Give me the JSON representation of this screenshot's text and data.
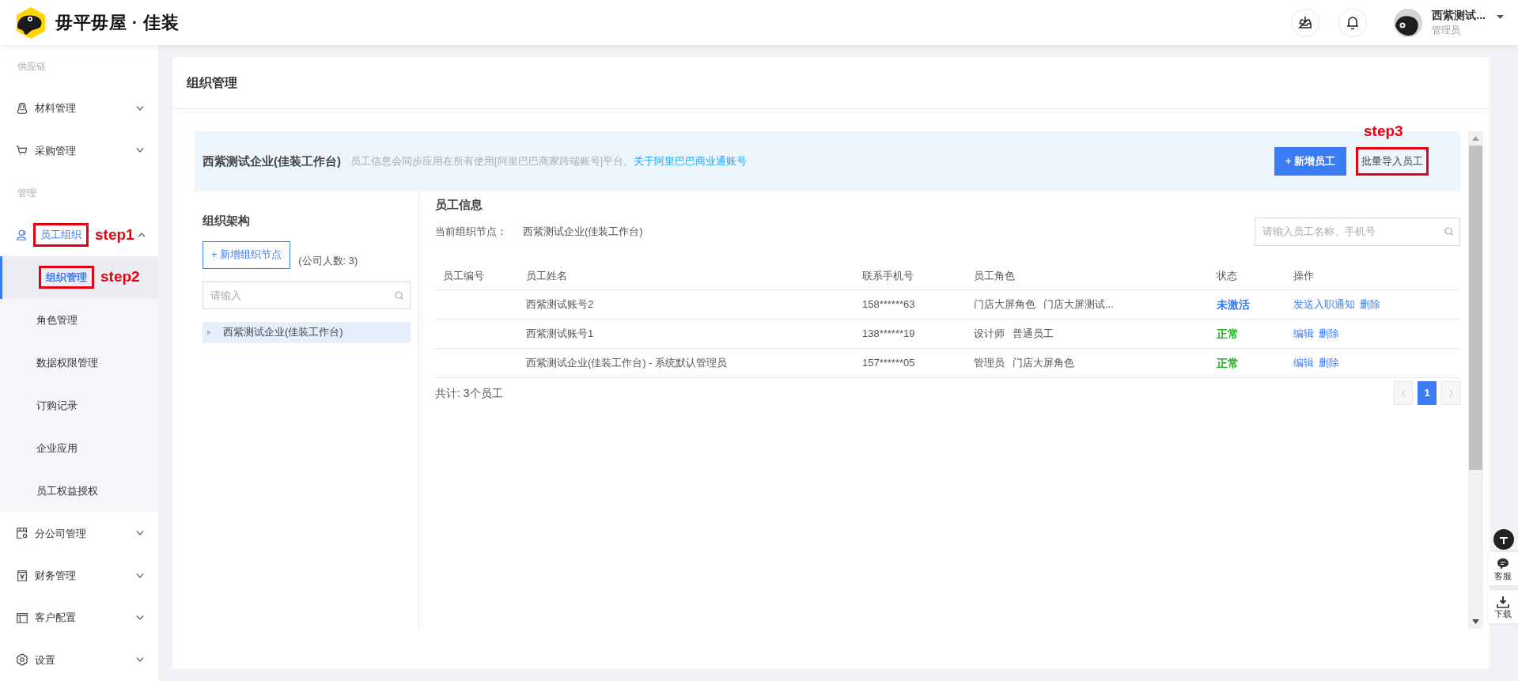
{
  "header": {
    "brand": "毋平毋屋 · 佳装",
    "user": {
      "name": "西紫测试...",
      "role": "管理员"
    }
  },
  "sidebar": {
    "sections": [
      {
        "label": "供应链",
        "items": [
          {
            "label": "材料管理",
            "expanded": false
          },
          {
            "label": "采购管理",
            "expanded": false
          }
        ]
      },
      {
        "label": "管理",
        "items": [
          {
            "label": "员工组织",
            "expanded": true,
            "callout": "step1",
            "children": [
              {
                "label": "组织管理",
                "selected": true,
                "callout": "step2"
              },
              {
                "label": "角色管理",
                "selected": false
              },
              {
                "label": "数据权限管理",
                "selected": false
              },
              {
                "label": "订购记录",
                "selected": false
              },
              {
                "label": "企业应用",
                "selected": false
              },
              {
                "label": "员工权益授权",
                "selected": false
              }
            ]
          },
          {
            "label": "分公司管理",
            "expanded": false
          },
          {
            "label": "财务管理",
            "expanded": false
          },
          {
            "label": "客户配置",
            "expanded": false
          },
          {
            "label": "设置",
            "expanded": false
          }
        ]
      }
    ]
  },
  "page": {
    "title": "组织管理",
    "banner": {
      "company": "西紫测试企业(佳装工作台)",
      "note": "员工信息会同步应用在所有使用[阿里巴巴商家跨端账号]平台。",
      "link": "关于阿里巴巴商业通账号",
      "buttons": [
        {
          "label": "+ 新增员工",
          "kind": "primary"
        },
        {
          "label": "批量导入员工",
          "kind": "plain",
          "callout": "step3"
        }
      ]
    },
    "org": {
      "title": "组织架构",
      "add_button": "+ 新增组织节点",
      "count": "(公司人数: 3)",
      "search": {
        "placeholder": "请输入"
      },
      "tree": [
        {
          "label": "西紫测试企业(佳装工作台)",
          "selected": true,
          "expanded": false
        }
      ]
    },
    "staff": {
      "title": "员工信息",
      "node_label": "当前组织节点：",
      "node_value": "西紫测试企业(佳装工作台)",
      "search": {
        "placeholder": "请输入员工名称、手机号"
      },
      "table": {
        "columns": [
          "员工编号",
          "员工姓名",
          "联系手机号",
          "员工角色",
          "状态",
          "操作"
        ],
        "rows": [
          {
            "name": "西紫测试账号2",
            "phone": "158******63",
            "roles": [
              "门店大屏角色",
              "门店大屏测试..."
            ],
            "status": "未激活",
            "color": "#3b7bf5",
            "actions": [
              "发送入职通知",
              "删除"
            ]
          },
          {
            "name": "西紫测试账号1",
            "phone": "138******19",
            "roles": [
              "设计师",
              "普通员工"
            ],
            "status": "正常",
            "color": "#1fb31f",
            "actions": [
              "编辑",
              "删除"
            ]
          },
          {
            "name": "西紫测试企业(佳装工作台) - 系统默认管理员",
            "phone": "157******05",
            "roles": [
              "管理员",
              "门店大屏角色"
            ],
            "status": "正常",
            "color": "#1fb31f",
            "actions": [
              "编辑",
              "删除"
            ]
          }
        ]
      },
      "total": "共计: 3个员工",
      "pages": [
        {
          "label": "1",
          "selected": true
        }
      ]
    }
  },
  "float_buttons": [
    {
      "label": "客服"
    },
    {
      "label": "下载"
    }
  ]
}
